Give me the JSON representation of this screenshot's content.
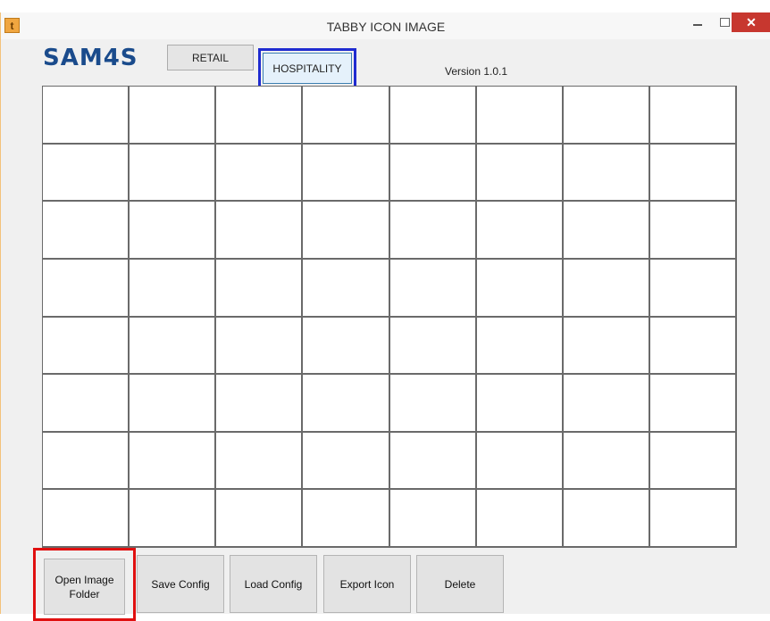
{
  "window": {
    "title": "TABBY ICON IMAGE",
    "app_icon_glyph": "t",
    "close_glyph": "✕"
  },
  "header": {
    "logo_text": "SAM4S",
    "tabs": [
      {
        "label": "RETAIL",
        "selected": false
      },
      {
        "label": "HOSPITALITY",
        "selected": true
      }
    ],
    "version": "Version 1.0.1"
  },
  "grid": {
    "rows": 8,
    "columns": 8
  },
  "actions": {
    "open_image_folder": "Open Image\nFolder",
    "save_config": "Save Config",
    "load_config": "Load Config",
    "export_icon": "Export Icon",
    "delete": "Delete"
  },
  "colors": {
    "highlight_blue": "#1f2bd0",
    "highlight_red": "#e01010",
    "logo_blue": "#1a4b8c",
    "close_red": "#c7372f"
  }
}
